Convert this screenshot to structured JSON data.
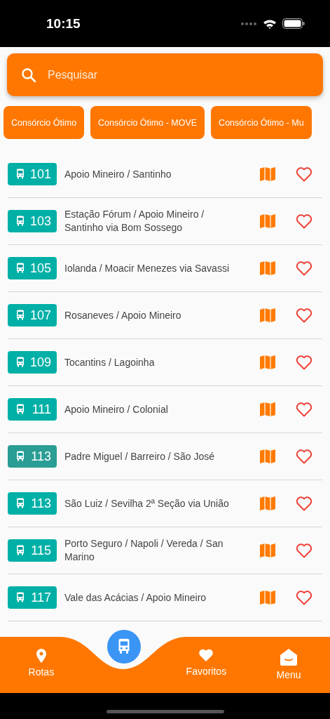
{
  "status_bar": {
    "time": "10:15"
  },
  "search": {
    "placeholder": "Pesquisar"
  },
  "filters": [
    {
      "label": "Consórcio Ótimo"
    },
    {
      "label": "Consórcio Ótimo - MOVE"
    },
    {
      "label": "Consórcio Ótimo - Mu"
    }
  ],
  "routes": [
    {
      "number": "101",
      "name": "Apoio Mineiro / Santinho",
      "color": "#00b0a6",
      "favorite": false
    },
    {
      "number": "103",
      "name": "Estação Fórum / Apoio Mineiro / Santinho via Bom Sossego",
      "color": "#00b0a6",
      "favorite": false
    },
    {
      "number": "105",
      "name": "Iolanda / Moacir Menezes via Savassi",
      "color": "#00b0a6",
      "favorite": false
    },
    {
      "number": "107",
      "name": "Rosaneves / Apoio Mineiro",
      "color": "#00b0a6",
      "favorite": false
    },
    {
      "number": "109",
      "name": "Tocantins / Lagoinha",
      "color": "#00b0a6",
      "favorite": false
    },
    {
      "number": "111",
      "name": "Apoio Mineiro / Colonial",
      "color": "#00b0a6",
      "favorite": false
    },
    {
      "number": "113",
      "name": "Padre Miguel / Barreiro / São José",
      "color": "#2a9d94",
      "favorite": false
    },
    {
      "number": "113",
      "name": "São Luiz / Sevilha 2ª Seção via União",
      "color": "#00b0a6",
      "favorite": false
    },
    {
      "number": "115",
      "name": "Porto Seguro / Napoli / Vereda / San Marino",
      "color": "#00b0a6",
      "favorite": false
    },
    {
      "number": "117",
      "name": "Vale das Acácias / Apoio Mineiro",
      "color": "#00b0a6",
      "favorite": false
    }
  ],
  "bottom_nav": [
    {
      "kind": "pin",
      "label": "Rotas"
    },
    {
      "kind": "bus"
    },
    {
      "kind": "heart",
      "label": "Favoritos"
    },
    {
      "kind": "menu",
      "label": "Menu"
    }
  ]
}
